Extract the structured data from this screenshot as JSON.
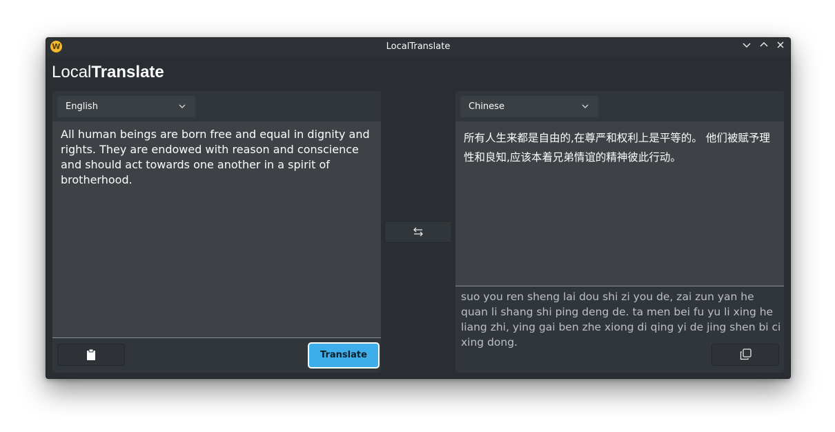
{
  "window": {
    "title": "LocalTranslate",
    "app_icon_letter": "W"
  },
  "header": {
    "title_light": "Local",
    "title_bold": "Translate"
  },
  "source": {
    "language": "English",
    "text": "All human beings are born free and equal in dignity and rights. They are endowed with reason and conscience and should act towards one another in a spirit of brotherhood."
  },
  "target": {
    "language": "Chinese",
    "text": "所有人生来都是自由的,在尊严和权利上是平等的。 他们被赋予理性和良知,应该本着兄弟情谊的精神彼此行动。",
    "pinyin": "suo you ren sheng lai dou shi zi you de, zai zun yan he quan li shang shi ping deng de. ta men bei fu yu li xing he liang zhi, ying gai ben zhe xiong di qing yi de jing shen bi ci xing dong."
  },
  "buttons": {
    "translate_label": "Translate"
  },
  "icons": {
    "window_minimize": "chevron-down-icon",
    "window_maximize": "chevron-up-icon",
    "window_close": "close-icon",
    "clipboard": "clipboard-icon",
    "swap": "swap-icon",
    "copy": "copy-icon"
  },
  "colors": {
    "accent": "#3daee9",
    "window_bg": "#2a2e32",
    "panel_bg": "#31363b",
    "text_area_bg": "#3e4247"
  }
}
